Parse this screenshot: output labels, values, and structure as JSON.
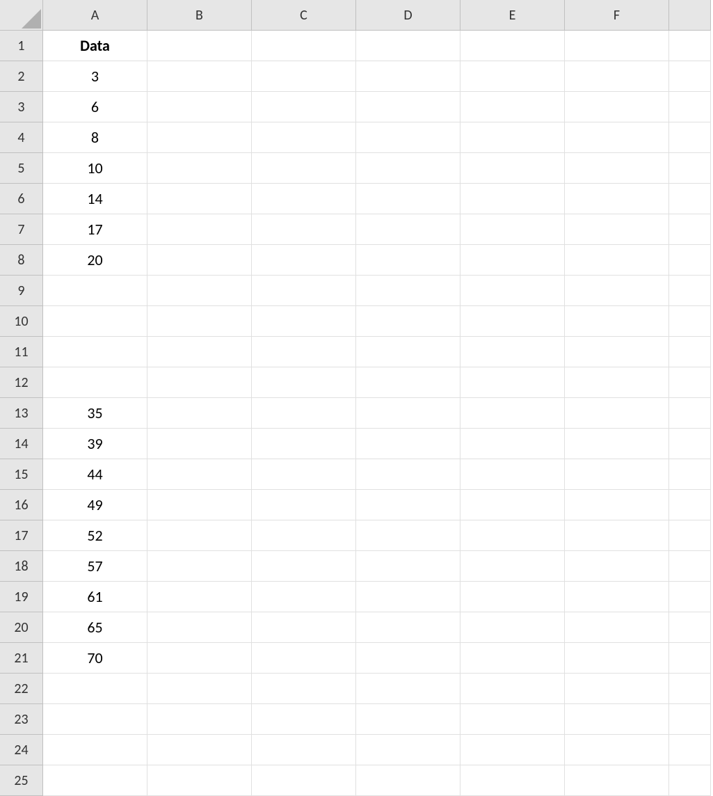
{
  "columns": [
    "A",
    "B",
    "C",
    "D",
    "E",
    "F",
    ""
  ],
  "rows": [
    {
      "num": "1",
      "cells": [
        "Data",
        "",
        "",
        "",
        "",
        "",
        ""
      ],
      "bold": [
        true,
        false,
        false,
        false,
        false,
        false,
        false
      ]
    },
    {
      "num": "2",
      "cells": [
        "3",
        "",
        "",
        "",
        "",
        "",
        ""
      ]
    },
    {
      "num": "3",
      "cells": [
        "6",
        "",
        "",
        "",
        "",
        "",
        ""
      ]
    },
    {
      "num": "4",
      "cells": [
        "8",
        "",
        "",
        "",
        "",
        "",
        ""
      ]
    },
    {
      "num": "5",
      "cells": [
        "10",
        "",
        "",
        "",
        "",
        "",
        ""
      ]
    },
    {
      "num": "6",
      "cells": [
        "14",
        "",
        "",
        "",
        "",
        "",
        ""
      ]
    },
    {
      "num": "7",
      "cells": [
        "17",
        "",
        "",
        "",
        "",
        "",
        ""
      ]
    },
    {
      "num": "8",
      "cells": [
        "20",
        "",
        "",
        "",
        "",
        "",
        ""
      ]
    },
    {
      "num": "9",
      "cells": [
        "",
        "",
        "",
        "",
        "",
        "",
        ""
      ]
    },
    {
      "num": "10",
      "cells": [
        "",
        "",
        "",
        "",
        "",
        "",
        ""
      ]
    },
    {
      "num": "11",
      "cells": [
        "",
        "",
        "",
        "",
        "",
        "",
        ""
      ]
    },
    {
      "num": "12",
      "cells": [
        "",
        "",
        "",
        "",
        "",
        "",
        ""
      ]
    },
    {
      "num": "13",
      "cells": [
        "35",
        "",
        "",
        "",
        "",
        "",
        ""
      ]
    },
    {
      "num": "14",
      "cells": [
        "39",
        "",
        "",
        "",
        "",
        "",
        ""
      ]
    },
    {
      "num": "15",
      "cells": [
        "44",
        "",
        "",
        "",
        "",
        "",
        ""
      ]
    },
    {
      "num": "16",
      "cells": [
        "49",
        "",
        "",
        "",
        "",
        "",
        ""
      ]
    },
    {
      "num": "17",
      "cells": [
        "52",
        "",
        "",
        "",
        "",
        "",
        ""
      ]
    },
    {
      "num": "18",
      "cells": [
        "57",
        "",
        "",
        "",
        "",
        "",
        ""
      ]
    },
    {
      "num": "19",
      "cells": [
        "61",
        "",
        "",
        "",
        "",
        "",
        ""
      ]
    },
    {
      "num": "20",
      "cells": [
        "65",
        "",
        "",
        "",
        "",
        "",
        ""
      ]
    },
    {
      "num": "21",
      "cells": [
        "70",
        "",
        "",
        "",
        "",
        "",
        ""
      ]
    },
    {
      "num": "22",
      "cells": [
        "",
        "",
        "",
        "",
        "",
        "",
        ""
      ]
    },
    {
      "num": "23",
      "cells": [
        "",
        "",
        "",
        "",
        "",
        "",
        ""
      ]
    },
    {
      "num": "24",
      "cells": [
        "",
        "",
        "",
        "",
        "",
        "",
        ""
      ]
    },
    {
      "num": "25",
      "cells": [
        "",
        "",
        "",
        "",
        "",
        "",
        ""
      ]
    }
  ]
}
